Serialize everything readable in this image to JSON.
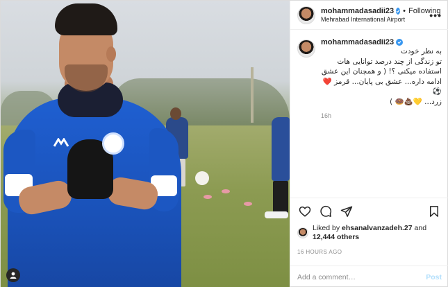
{
  "header": {
    "username": "mohammadasadii23",
    "separator": "•",
    "follow_status": "Following",
    "location": "Mehrabad International Airport",
    "more_icon": "more-horizontal-icon"
  },
  "caption": {
    "username": "mohammadasadii23",
    "lines": [
      "به نظر خودت",
      "تو زندگی از چند درصد توانایی هات",
      "استفاده میکنی ؟! ( و همچنان این عشق",
      "ادامه داره... عشق بی پایان... قرمز ❤️⚽",
      "زرد... 💛💩🍩 )"
    ],
    "time": "16h"
  },
  "actions": {
    "like_icon": "heart-icon",
    "comment_icon": "comment-icon",
    "share_icon": "share-icon",
    "save_icon": "bookmark-icon"
  },
  "likes": {
    "prefix": "Liked by ",
    "user": "ehsanalvanzadeh.27",
    "middle": " and",
    "count": "12,444 others"
  },
  "time_ago": "16 HOURS AGO",
  "comment_box": {
    "placeholder": "Add a comment…",
    "post_label": "Post"
  },
  "colors": {
    "verified": "#3897f0",
    "post_button_disabled": "#b2dffc",
    "jersey_blue": "#1f5fd1",
    "border": "#dbdbdb"
  }
}
